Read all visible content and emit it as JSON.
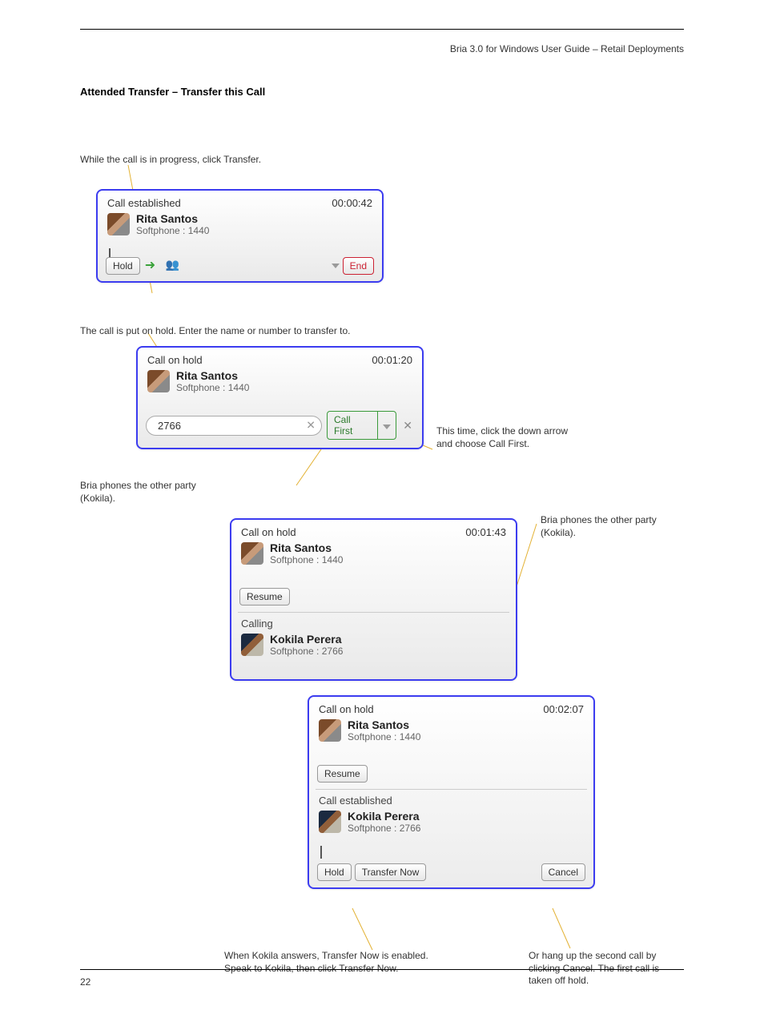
{
  "header_right": "Bria 3.0 for Windows User Guide – Retail Deployments",
  "section_heading": "Attended Transfer – Transfer this Call",
  "annotations": {
    "a1": "While the call is in progress, click Transfer.",
    "a2": "The call is put on hold. Enter the name or number to transfer to.",
    "a3_line1": "This time, click the down arrow",
    "a3_line2": "and choose Call First.",
    "a4_line1": "Bria phones the other party",
    "a4_line2": "(Kokila).",
    "a5_line1": "When Kokila answers, Transfer Now is enabled.",
    "a5_line2": "Speak to Kokila, then click Transfer Now.",
    "a6_line1": "Or hang up the second call by",
    "a6_line2": "clicking Cancel. The first call is",
    "a6_line3": "taken off hold."
  },
  "panel1": {
    "status": "Call established",
    "timer": "00:00:42",
    "name": "Rita Santos",
    "sub": "Softphone : 1440",
    "hold_btn": "Hold",
    "end_btn": "End"
  },
  "panel2": {
    "status": "Call on hold",
    "timer": "00:01:20",
    "name": "Rita Santos",
    "sub": "Softphone : 1440",
    "dial_value": "2766",
    "call_first_btn": "Call First"
  },
  "panel3": {
    "status": "Call on hold",
    "timer": "00:01:43",
    "name": "Rita Santos",
    "sub": "Softphone : 1440",
    "resume_btn": "Resume",
    "secondary_status": "Calling",
    "name2": "Kokila Perera",
    "sub2": "Softphone : 2766"
  },
  "panel4": {
    "status": "Call on hold",
    "timer": "00:02:07",
    "name": "Rita Santos",
    "sub": "Softphone : 1440",
    "resume_btn": "Resume",
    "secondary_status": "Call established",
    "name2": "Kokila Perera",
    "sub2": "Softphone : 2766",
    "hold_btn": "Hold",
    "transfer_btn": "Transfer Now",
    "cancel_btn": "Cancel"
  },
  "footer_page": "22"
}
